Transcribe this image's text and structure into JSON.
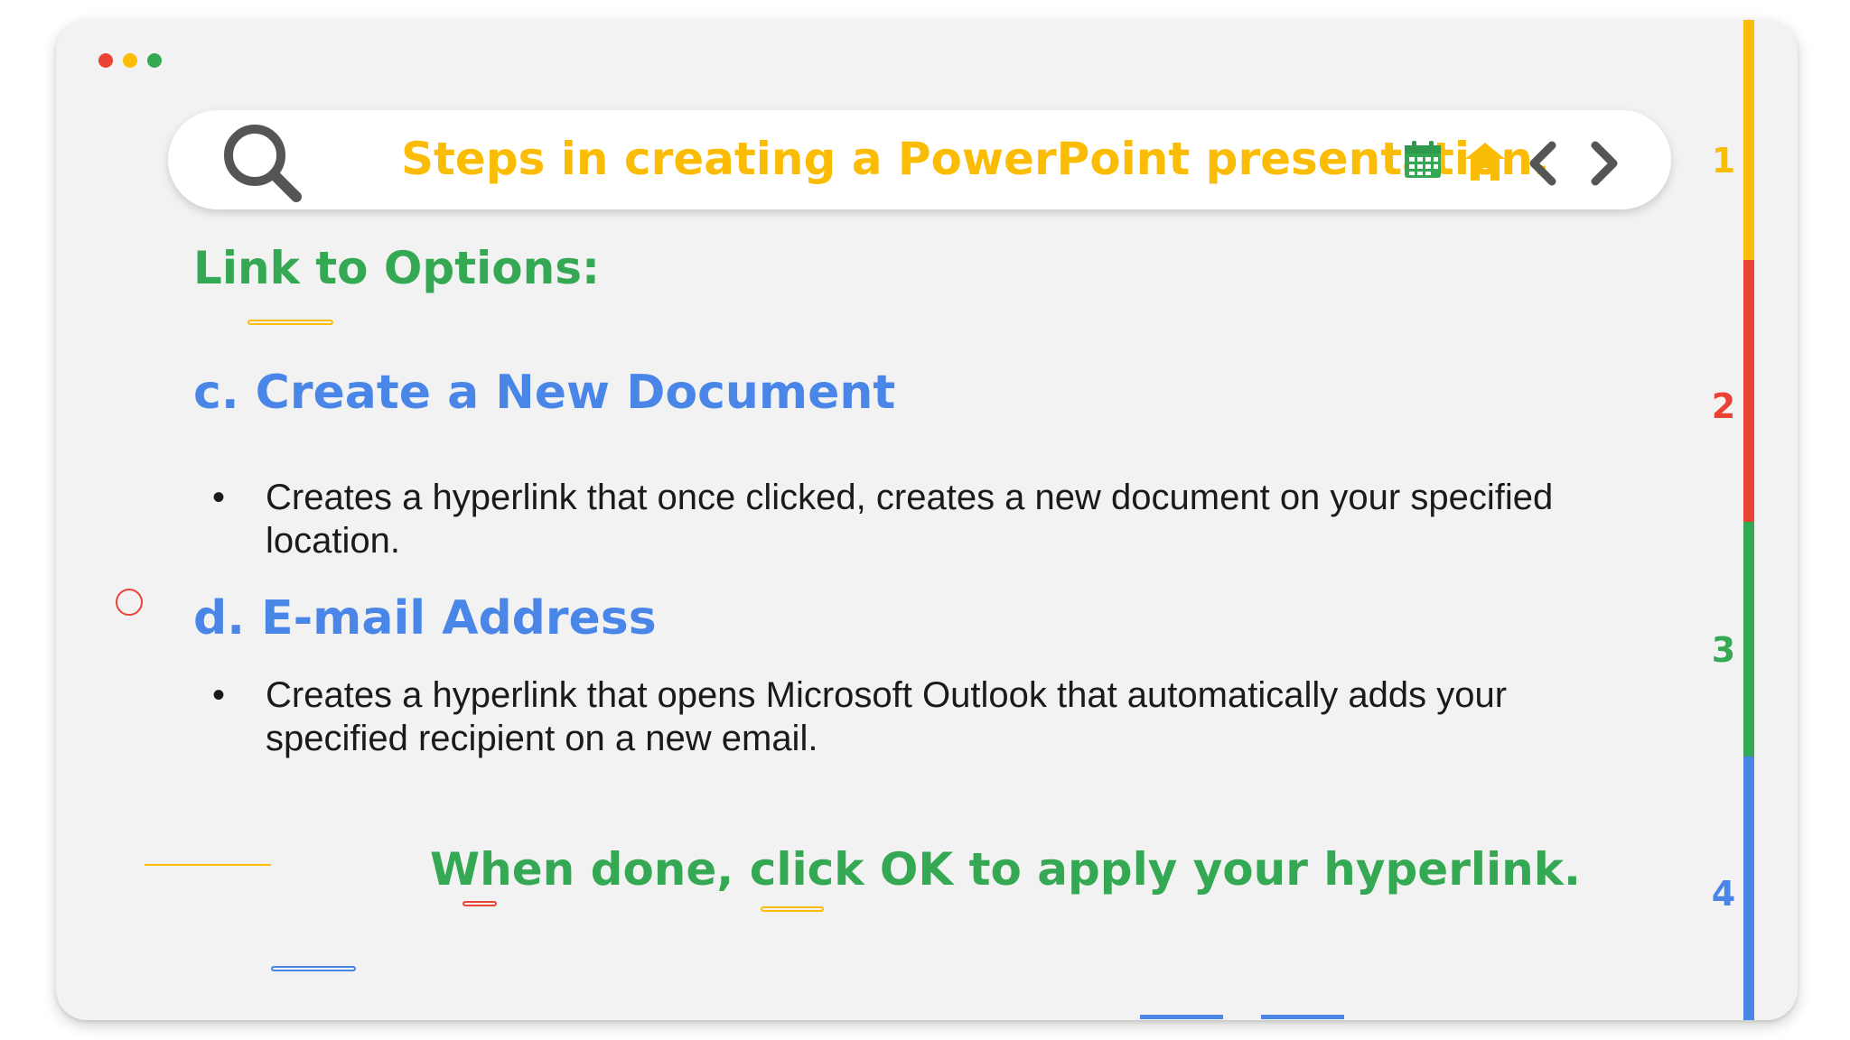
{
  "window": {
    "controls": [
      "close",
      "minimize",
      "maximize"
    ],
    "colors": {
      "close": "#ea4335",
      "minimize": "#fbbc05",
      "maximize": "#34a853"
    }
  },
  "search_bar": {
    "icon": "search-icon",
    "title": "Steps in creating a PowerPoint presentation.",
    "title_color": "#fbbc05",
    "actions": [
      {
        "icon": "calendar-icon",
        "color": "#34a853"
      },
      {
        "icon": "home-icon",
        "color": "#fbbc05"
      },
      {
        "icon": "chevron-left-icon",
        "color": "#555555"
      },
      {
        "icon": "chevron-right-icon",
        "color": "#555555"
      }
    ]
  },
  "content": {
    "section_title": "Link to Options:",
    "items": [
      {
        "heading": "c. Create a New Document",
        "bullet": "•",
        "text_line1": "Creates a hyperlink that once clicked, creates a new document on your specified",
        "text_line2": "location."
      },
      {
        "heading": "d. E-mail Address",
        "bullet": "•",
        "text_line1": "Creates a hyperlink that opens Microsoft Outlook that automatically adds your",
        "text_line2": "specified recipient on a new email."
      }
    ],
    "footer_note": "When done, click OK to apply your hyperlink."
  },
  "side_tabs": [
    {
      "label": "1",
      "color": "#fbbc05"
    },
    {
      "label": "2",
      "color": "#ea4335"
    },
    {
      "label": "3",
      "color": "#34a853"
    },
    {
      "label": "4",
      "color": "#4a86e8"
    }
  ]
}
